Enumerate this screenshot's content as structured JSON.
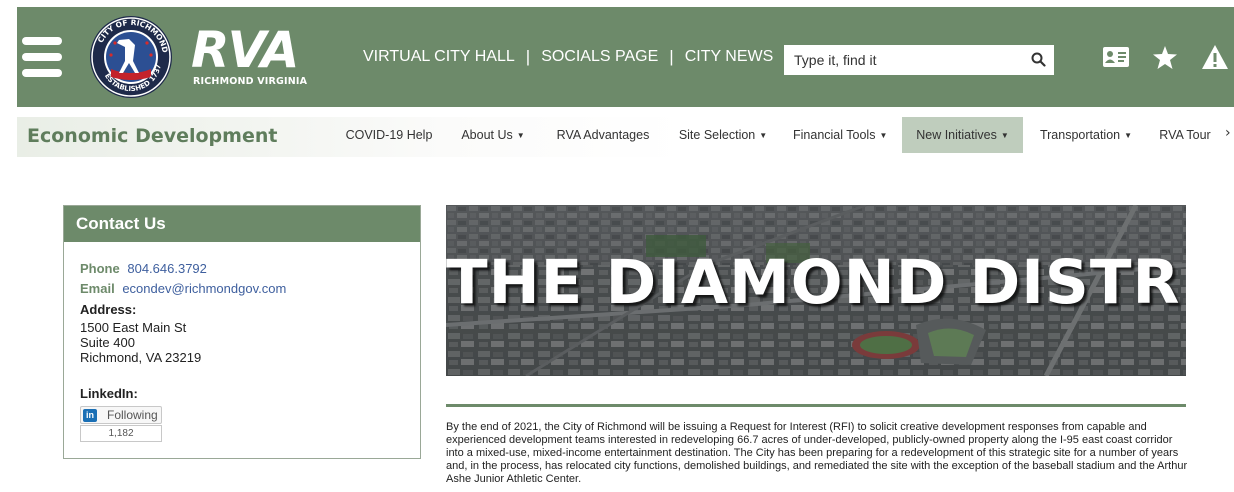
{
  "header": {
    "logo_text": "RVA",
    "logo_subtext": "RICHMOND VIRGINIA",
    "seal_text": "CITY OF RICHMOND · ESTABLISHED 1737",
    "nav": [
      {
        "label": "VIRTUAL CITY HALL"
      },
      {
        "label": "SOCIALS PAGE"
      },
      {
        "label": "CITY NEWS"
      }
    ],
    "separator": "|",
    "search": {
      "placeholder": "Type it, find it"
    },
    "icons": [
      "contact-card-icon",
      "star-icon",
      "alert-icon"
    ],
    "colors": {
      "primary": "#6d8a6a",
      "text": "#ffffff"
    }
  },
  "subnav": {
    "site_name": "Economic Development",
    "items": [
      {
        "label": "COVID-19 Help",
        "dropdown": false
      },
      {
        "label": "About Us",
        "dropdown": true
      },
      {
        "label": "RVA Advantages",
        "dropdown": false
      },
      {
        "label": "Site Selection",
        "dropdown": true
      },
      {
        "label": "Financial Tools",
        "dropdown": true
      },
      {
        "label": "New Initiatives",
        "dropdown": true,
        "active": true
      },
      {
        "label": "Transportation",
        "dropdown": true
      },
      {
        "label": "RVA Tour",
        "dropdown": false
      }
    ],
    "more_label": "›"
  },
  "contact": {
    "title": "Contact Us",
    "phone_label": "Phone",
    "phone": "804.646.3792",
    "email_label": "Email",
    "email": "econdev@richmondgov.com",
    "address_label": "Address:",
    "address_lines": [
      "1500 East Main St",
      "Suite 400",
      "Richmond, VA 23219"
    ],
    "linkedin_label": "LinkedIn:",
    "linkedin_badge": "in",
    "linkedin_button": "Following",
    "linkedin_count": "1,182"
  },
  "hero": {
    "title": "THE DIAMOND DISTRICT"
  },
  "article": {
    "paragraph": "By the end of 2021, the City of Richmond will be issuing a Request for Interest (RFI) to solicit creative development responses from capable and experienced development teams interested in redeveloping 66.7 acres of under-developed, publicly-owned property along the I-95 east coast corridor into a mixed-use, mixed-income entertainment destination. The City has been preparing for a redevelopment of this strategic site for a number of years and, in the process, has relocated city functions, demolished buildings, and remediated the site with the exception of the baseball stadium and the Arthur Ashe Junior Athletic Center."
  }
}
